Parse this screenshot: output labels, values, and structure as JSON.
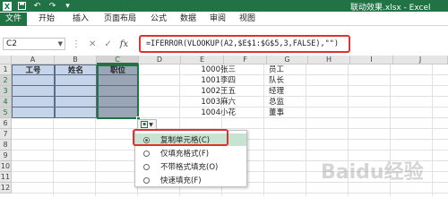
{
  "window": {
    "title": "联动效果.xlsx - Excel",
    "brand_color": "#217346",
    "qat_icons": [
      "excel-logo-icon",
      "save-icon",
      "undo-icon",
      "redo-icon",
      "customize-icon"
    ]
  },
  "ribbon": {
    "tabs": [
      {
        "label": "文件"
      },
      {
        "label": "开始"
      },
      {
        "label": "插入"
      },
      {
        "label": "页面布局"
      },
      {
        "label": "公式"
      },
      {
        "label": "数据"
      },
      {
        "label": "审阅"
      },
      {
        "label": "视图"
      }
    ]
  },
  "formula_bar": {
    "name_box": "C2",
    "formula": "=IFERROR(VLOOKUP(A2,$E$1:$G$5,3,FALSE),\"\")",
    "icons": [
      "more-icon",
      "cancel-icon",
      "enter-icon",
      "fx-icon"
    ]
  },
  "grid": {
    "columns": [
      "A",
      "B",
      "C",
      "D",
      "E",
      "F",
      "G",
      "H",
      "I",
      "J"
    ],
    "selected_column": "C",
    "rows": [
      "1",
      "2",
      "3",
      "4",
      "5",
      "6",
      "7",
      "8",
      "9",
      "10",
      "11",
      "12"
    ],
    "selected_rows": [
      "2",
      "3",
      "4",
      "5"
    ],
    "table_headers": [
      "工号",
      "姓名",
      "职位"
    ],
    "lookup_table": [
      {
        "id": "1000",
        "name": "张三",
        "position": "员工"
      },
      {
        "id": "1001",
        "name": "李四",
        "position": "队长"
      },
      {
        "id": "1002",
        "name": "王五",
        "position": "经理"
      },
      {
        "id": "1003",
        "name": "麻六",
        "position": "总监"
      },
      {
        "id": "1004",
        "name": "小花",
        "position": "董事"
      }
    ]
  },
  "paste_options": {
    "items": [
      {
        "label": "复制单元格(C)",
        "selected": true
      },
      {
        "label": "仅填充格式(F)",
        "selected": false
      },
      {
        "label": "不带格式填充(O)",
        "selected": false
      },
      {
        "label": "快速填充(F)",
        "selected": false
      }
    ]
  },
  "watermark": "Baidu经验"
}
